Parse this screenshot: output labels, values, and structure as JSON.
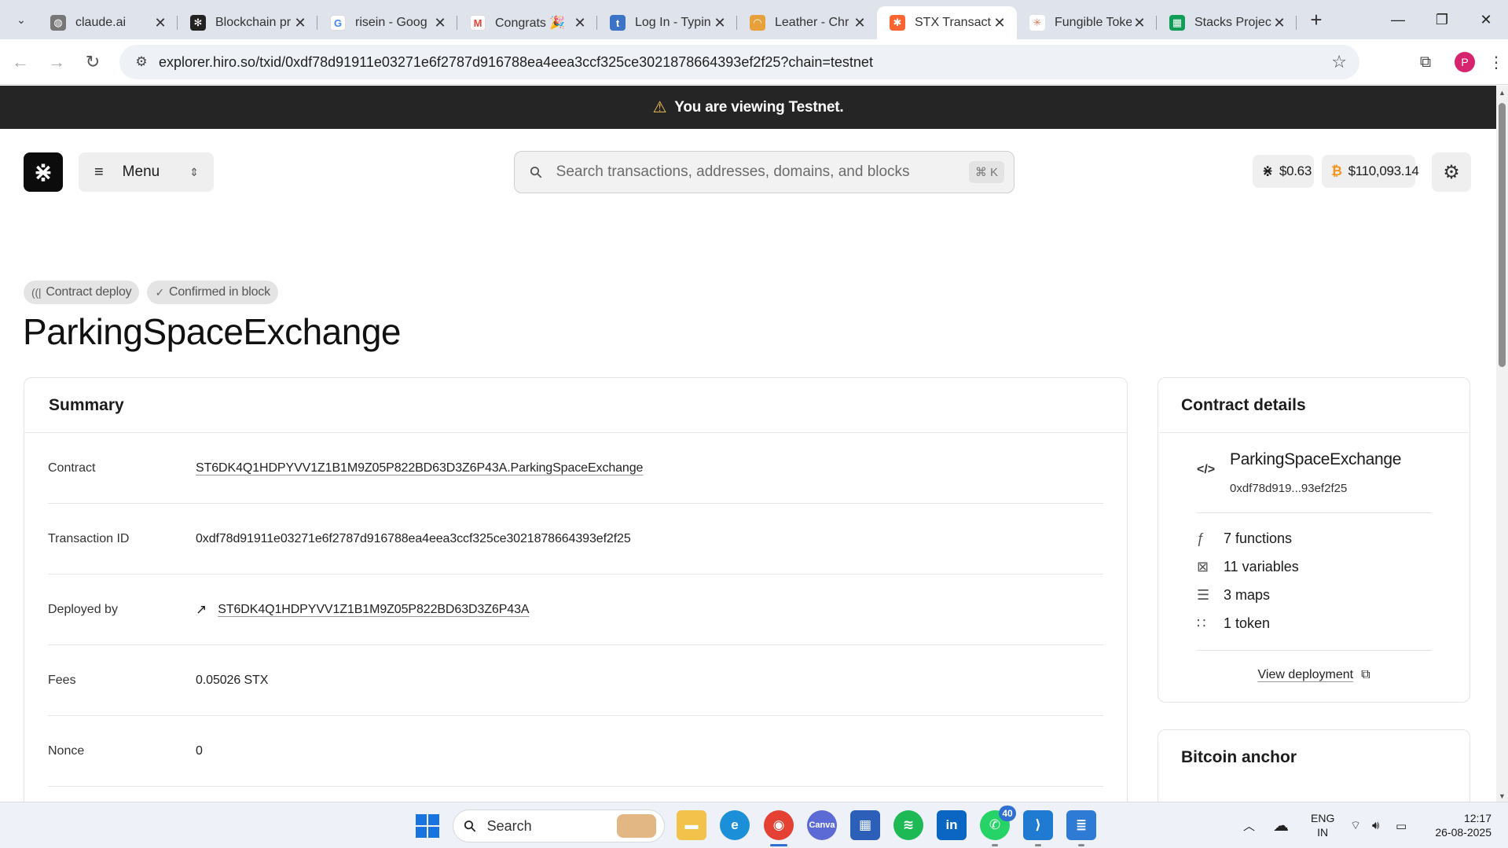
{
  "browser": {
    "tabs": [
      {
        "title": "claude.ai",
        "favicon_color": "#777777",
        "favicon": "globe-icon",
        "active": false
      },
      {
        "title": "Blockchain pr",
        "favicon_color": "#222222",
        "favicon": "openai-icon",
        "active": false
      },
      {
        "title": "risein - Goog",
        "favicon_color": "#4285f4",
        "favicon": "google-icon",
        "active": false
      },
      {
        "title": "Congrats 🎉",
        "favicon_color": "#ea4335",
        "favicon": "gmail-icon",
        "active": false
      },
      {
        "title": "Log In - Typin",
        "favicon_color": "#3b73c6",
        "favicon": "typing-icon",
        "active": false
      },
      {
        "title": "Leather - Chr",
        "favicon_color": "#e8a13a",
        "favicon": "chrome-store-icon",
        "active": false
      },
      {
        "title": "STX Transacti",
        "favicon_color": "#fc6432",
        "favicon": "stacks-icon",
        "active": true
      },
      {
        "title": "Fungible Toke",
        "favicon_color": "#d97757",
        "favicon": "claude-icon",
        "active": false
      },
      {
        "title": "Stacks Projec",
        "favicon_color": "#0f9d58",
        "favicon": "sheets-icon",
        "active": false
      }
    ],
    "url": "explorer.hiro.so/txid/0xdf78d91911e03271e6f2787d916788ea4eea3ccf325ce3021878664393ef2f25?chain=testnet",
    "profile_initial": "P"
  },
  "banner": {
    "text": "You are viewing Testnet."
  },
  "header": {
    "menu_label": "Menu",
    "search_placeholder": "Search transactions, addresses, domains, and blocks",
    "search_shortcut": "⌘ K",
    "stx_price": "$0.63",
    "btc_price": "$110,093.14"
  },
  "tx": {
    "badges": [
      "Contract deploy",
      "Confirmed in block"
    ],
    "title": "ParkingSpaceExchange"
  },
  "summary": {
    "heading": "Summary",
    "rows": [
      {
        "key": "Contract",
        "value": "ST6DK4Q1HDPYVV1Z1B1M9Z05P822BD63D3Z6P43A.ParkingSpaceExchange"
      },
      {
        "key": "Transaction ID",
        "value": "0xdf78d91911e03271e6f2787d916788ea4eea3ccf325ce3021878664393ef2f25"
      },
      {
        "key": "Deployed by",
        "value": "ST6DK4Q1HDPYVV1Z1B1M9Z05P822BD63D3Z6P43A"
      },
      {
        "key": "Fees",
        "value": "0.05026 STX"
      },
      {
        "key": "Nonce",
        "value": "0"
      }
    ]
  },
  "contract_details": {
    "heading": "Contract details",
    "name": "ParkingSpaceExchange",
    "hash": "0xdf78d919...93ef2f25",
    "stats": [
      "7 functions",
      "11 variables",
      "3 maps",
      "1 token"
    ],
    "view_deployment": "View deployment"
  },
  "bitcoin_anchor": {
    "heading": "Bitcoin anchor"
  },
  "taskbar": {
    "search_label": "Search",
    "whatsapp_badge": "40",
    "lang_1": "ENG",
    "lang_2": "IN",
    "time": "12:17",
    "date": "26-08-2025"
  }
}
